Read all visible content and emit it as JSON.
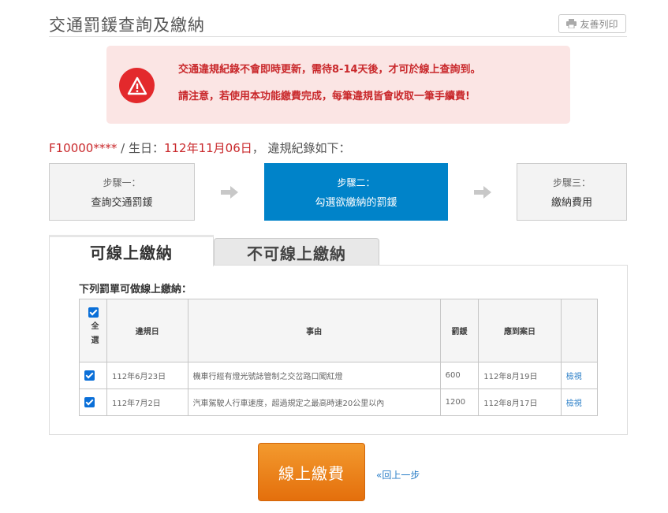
{
  "page": {
    "title": "交通罰鍰查詢及繳納",
    "print_label": "友善列印"
  },
  "alert": {
    "line1": "交通違規紀錄不會即時更新，需待8-14天後，才可於線上查詢到。",
    "line2": "請注意，若使用本功能繳費完成，每筆違規皆會收取一筆手續費!"
  },
  "summary": {
    "id": "F10000****",
    "sep1": " / 生日：",
    "birthday": "112年11月06日",
    "suffix": "， 違規紀錄如下："
  },
  "steps": [
    {
      "label": "步驟一：",
      "title": "查詢交通罰鍰"
    },
    {
      "label": "步驟二：",
      "title": "勾選欲繳納的罰鍰"
    },
    {
      "label": "步驟三：",
      "title": "繳納費用"
    }
  ],
  "tabs": {
    "online": "可線上繳納",
    "offline": "不可線上繳納"
  },
  "table": {
    "heading": "下列罰單可做線上繳納：",
    "select_all": "全選",
    "columns": [
      "違規日",
      "事由",
      "罰鍰",
      "應到案日"
    ],
    "rows": [
      {
        "date": "112年6月23日",
        "reason": "機車行經有燈光號誌管制之交岔路口闖紅燈",
        "amount": "600",
        "due": "112年8月19日",
        "action": "檢視",
        "checked": true
      },
      {
        "date": "112年7月2日",
        "reason": "汽車駕駛人行車速度，超過規定之最高時速20公里以內",
        "amount": "1200",
        "due": "112年8月17日",
        "action": "檢視",
        "checked": true
      }
    ]
  },
  "actions": {
    "pay_label": "線上繳費",
    "back_label": "«回上一步"
  },
  "colors": {
    "accent": "#0083c9",
    "alert_red": "#e3292c",
    "pay_orange": "#ef8a1f"
  }
}
